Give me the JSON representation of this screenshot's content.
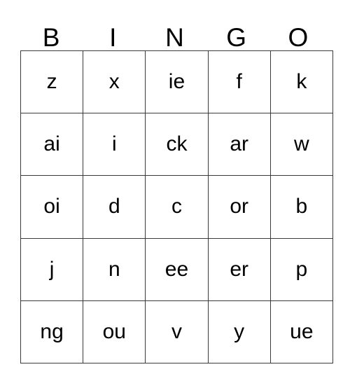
{
  "card": {
    "title": "BINGO",
    "header_letters": [
      "B",
      "I",
      "N",
      "G",
      "O"
    ],
    "rows": [
      [
        "z",
        "x",
        "ie",
        "f",
        "k"
      ],
      [
        "ai",
        "i",
        "ck",
        "ar",
        "w"
      ],
      [
        "oi",
        "d",
        "c",
        "or",
        "b"
      ],
      [
        "j",
        "n",
        "ee",
        "er",
        "p"
      ],
      [
        "ng",
        "ou",
        "v",
        "y",
        "ue"
      ]
    ],
    "colors": {
      "background": "#ffffff",
      "border": "#3a3a3a",
      "text": "#000000"
    }
  }
}
